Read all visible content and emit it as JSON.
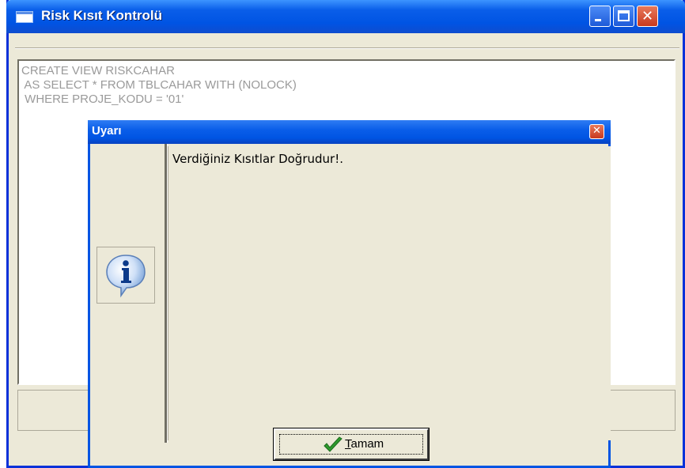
{
  "window": {
    "title": "Risk Kısıt Kontrolü",
    "controls": {
      "minimize": "minimize-icon",
      "maximize": "maximize-icon",
      "close": "close-icon"
    }
  },
  "editor": {
    "lines": [
      "CREATE VIEW RISKCAHAR",
      " AS SELECT * FROM TBLCAHAR WITH (NOLOCK)",
      " WHERE PROJE_KODU = '01'"
    ]
  },
  "dialog": {
    "title": "Uyarı",
    "close_icon": "close-icon",
    "icon": "information-icon",
    "message": "Verdiğiniz Kısıtlar Doğrudur!.",
    "ok_button": {
      "icon": "checkmark-icon",
      "accelerator": "T",
      "rest": "amam"
    }
  },
  "colors": {
    "titlebar_blue": "#0054e3",
    "face": "#ece9d8",
    "close_red": "#c8391f",
    "check_green": "#2e9a2e"
  }
}
